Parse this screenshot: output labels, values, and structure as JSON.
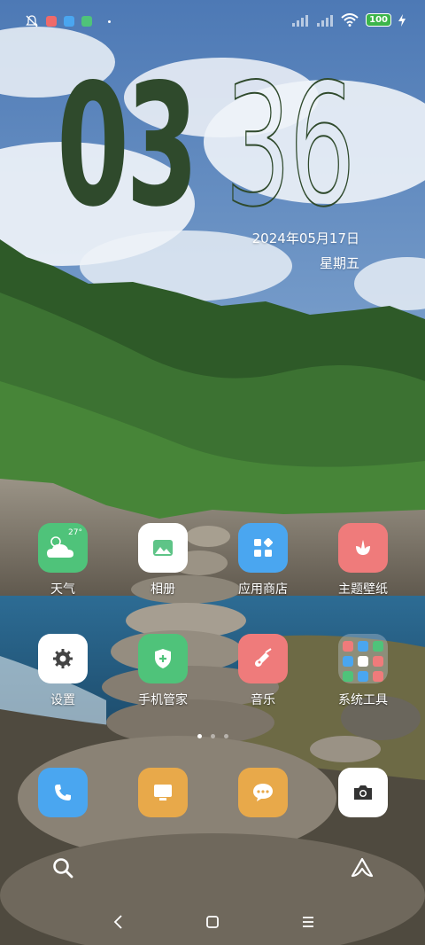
{
  "status_bar": {
    "battery": "100",
    "icons": [
      "bell-muted-icon",
      "notif-app-1",
      "notif-app-2",
      "notif-app-3",
      "dot",
      "signal-1-icon",
      "signal-2-icon",
      "wifi-icon",
      "battery-icon",
      "charging-icon"
    ]
  },
  "clock": {
    "hours": "03",
    "minutes": "36",
    "date": "2024年05月17日",
    "weekday": "星期五"
  },
  "weather_temp": "27°",
  "apps_row1": [
    {
      "label": "天气",
      "icon": "weather-icon",
      "color": "#4fc37a"
    },
    {
      "label": "相册",
      "icon": "gallery-icon",
      "color": "#ffffff"
    },
    {
      "label": "应用商店",
      "icon": "app-store-icon",
      "color": "#4aa6f0"
    },
    {
      "label": "主题壁纸",
      "icon": "theme-icon",
      "color": "#ef7b7b"
    }
  ],
  "apps_row2": [
    {
      "label": "设置",
      "icon": "settings-icon",
      "color": "#ffffff"
    },
    {
      "label": "手机管家",
      "icon": "security-icon",
      "color": "#4fc37a"
    },
    {
      "label": "音乐",
      "icon": "music-icon",
      "color": "#ef7b7b"
    },
    {
      "label": "系统工具",
      "icon": "folder-icon",
      "color": "#c8d2dc"
    }
  ],
  "dock": [
    {
      "icon": "phone-icon",
      "color": "#4aa6f0"
    },
    {
      "icon": "desktop-icon",
      "color": "#e8a94a"
    },
    {
      "icon": "messages-icon",
      "color": "#e8a94a"
    },
    {
      "icon": "camera-icon",
      "color": "#ffffff"
    }
  ],
  "pager": {
    "pages": 3,
    "active": 1
  }
}
